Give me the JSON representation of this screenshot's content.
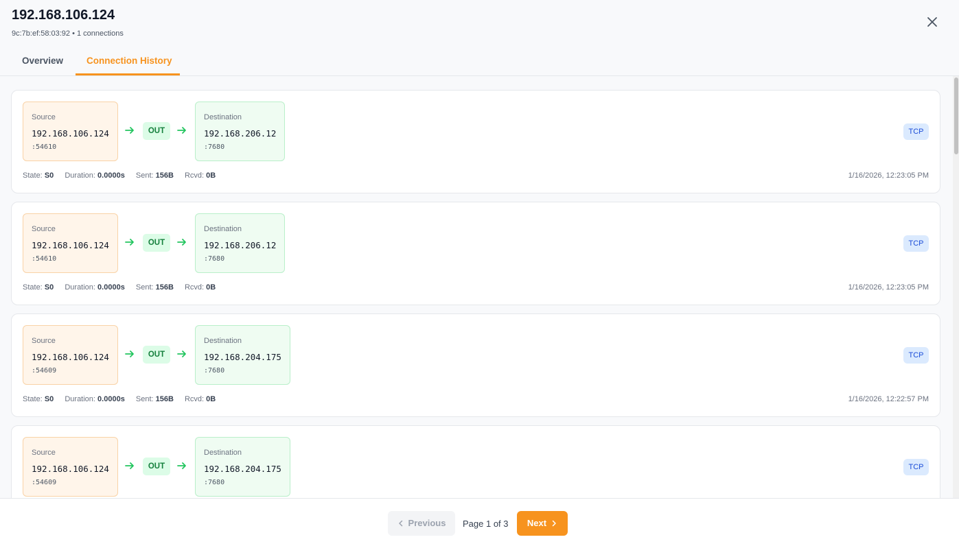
{
  "header": {
    "title": "192.168.106.124",
    "subtitle": "9c:7b:ef:58:03:92 • 1 connections",
    "tabs": [
      {
        "label": "Overview",
        "active": false
      },
      {
        "label": "Connection History",
        "active": true
      }
    ]
  },
  "colors": {
    "accent": "#f7931e",
    "direction_badge": "#dcfce7",
    "protocol_badge": "#dbeafe"
  },
  "connections": [
    {
      "source_label": "Source",
      "source_ip": "192.168.106.124",
      "source_port": ":54610",
      "direction": "OUT",
      "dest_label": "Destination",
      "dest_ip": "192.168.206.12",
      "dest_port": ":7680",
      "protocol": "TCP",
      "state_label": "State:",
      "state": "S0",
      "duration_label": "Duration:",
      "duration": "0.0000s",
      "sent_label": "Sent:",
      "sent": "156B",
      "rcvd_label": "Rcvd:",
      "rcvd": "0B",
      "timestamp": "1/16/2026, 12:23:05 PM"
    },
    {
      "source_label": "Source",
      "source_ip": "192.168.106.124",
      "source_port": ":54610",
      "direction": "OUT",
      "dest_label": "Destination",
      "dest_ip": "192.168.206.12",
      "dest_port": ":7680",
      "protocol": "TCP",
      "state_label": "State:",
      "state": "S0",
      "duration_label": "Duration:",
      "duration": "0.0000s",
      "sent_label": "Sent:",
      "sent": "156B",
      "rcvd_label": "Rcvd:",
      "rcvd": "0B",
      "timestamp": "1/16/2026, 12:23:05 PM"
    },
    {
      "source_label": "Source",
      "source_ip": "192.168.106.124",
      "source_port": ":54609",
      "direction": "OUT",
      "dest_label": "Destination",
      "dest_ip": "192.168.204.175",
      "dest_port": ":7680",
      "protocol": "TCP",
      "state_label": "State:",
      "state": "S0",
      "duration_label": "Duration:",
      "duration": "0.0000s",
      "sent_label": "Sent:",
      "sent": "156B",
      "rcvd_label": "Rcvd:",
      "rcvd": "0B",
      "timestamp": "1/16/2026, 12:22:57 PM"
    },
    {
      "source_label": "Source",
      "source_ip": "192.168.106.124",
      "source_port": ":54609",
      "direction": "OUT",
      "dest_label": "Destination",
      "dest_ip": "192.168.204.175",
      "dest_port": ":7680",
      "protocol": "TCP"
    }
  ],
  "pagination": {
    "previous_label": "Previous",
    "page_info": "Page 1 of 3",
    "next_label": "Next"
  },
  "icons": {
    "close": "close-icon",
    "arrow": "arrow-right-icon",
    "prev": "chevron-left-icon",
    "next": "chevron-right-icon"
  }
}
